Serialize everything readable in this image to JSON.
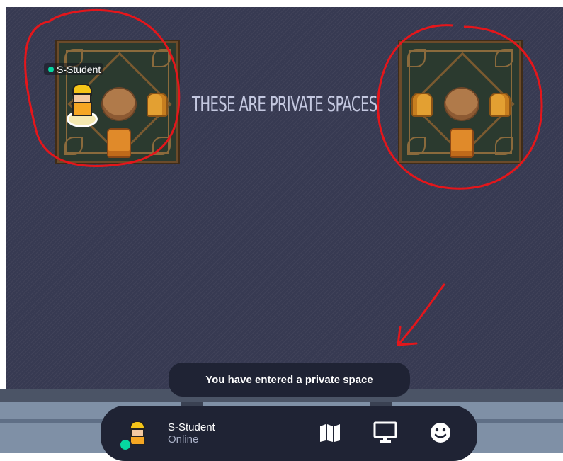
{
  "scene": {
    "caption": "THESE ARE PRIVATE SPACES",
    "player_name": "S-Student"
  },
  "toast": {
    "message": "You have entered a private space"
  },
  "dock": {
    "user_name": "S-Student",
    "user_status": "Online",
    "buttons": [
      "map-icon",
      "screen-share-icon",
      "emoji-icon"
    ]
  },
  "colors": {
    "scene_bg": "#373a52",
    "dock_bg": "#1f2334",
    "online_dot": "#06d6a0",
    "annotation": "#e4161b"
  }
}
